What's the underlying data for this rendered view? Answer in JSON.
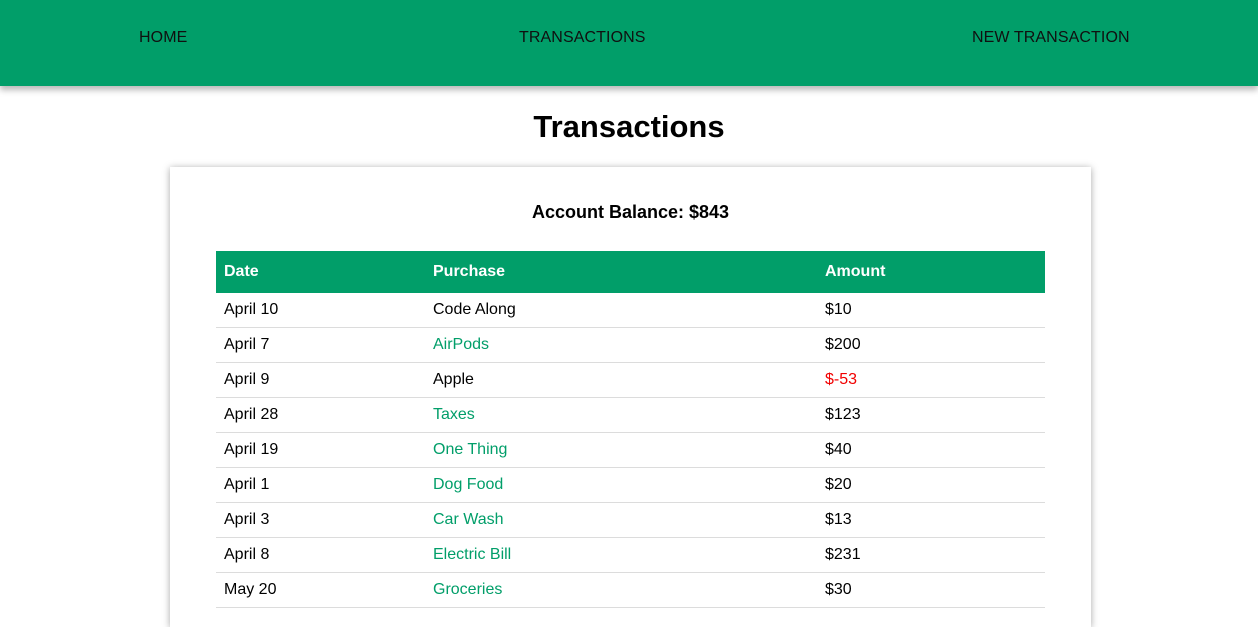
{
  "nav": {
    "home": "HOME",
    "transactions": "TRANSACTIONS",
    "new_transaction": "NEW TRANSACTION"
  },
  "page": {
    "title": "Transactions",
    "balance": "Account Balance: $843"
  },
  "table": {
    "headers": [
      "Date",
      "Purchase",
      "Amount"
    ],
    "rows": [
      {
        "date": "April 10",
        "purchase": "Code Along",
        "amount": "$10"
      },
      {
        "date": "April 7",
        "purchase": "AirPods",
        "amount": "$200"
      },
      {
        "date": "April 9",
        "purchase": "Apple",
        "amount": "$-53"
      },
      {
        "date": "April 28",
        "purchase": "Taxes",
        "amount": "$123"
      },
      {
        "date": "April 19",
        "purchase": "One Thing",
        "amount": "$40"
      },
      {
        "date": "April 1",
        "purchase": "Dog Food",
        "amount": "$20"
      },
      {
        "date": "April 3",
        "purchase": "Car Wash",
        "amount": "$13"
      },
      {
        "date": "April 8",
        "purchase": "Electric Bill",
        "amount": "$231"
      },
      {
        "date": "May 20",
        "purchase": "Groceries",
        "amount": "$30"
      }
    ]
  },
  "colors": {
    "brand": "#019e69",
    "negative": "#f10000",
    "link": "#019e69"
  }
}
